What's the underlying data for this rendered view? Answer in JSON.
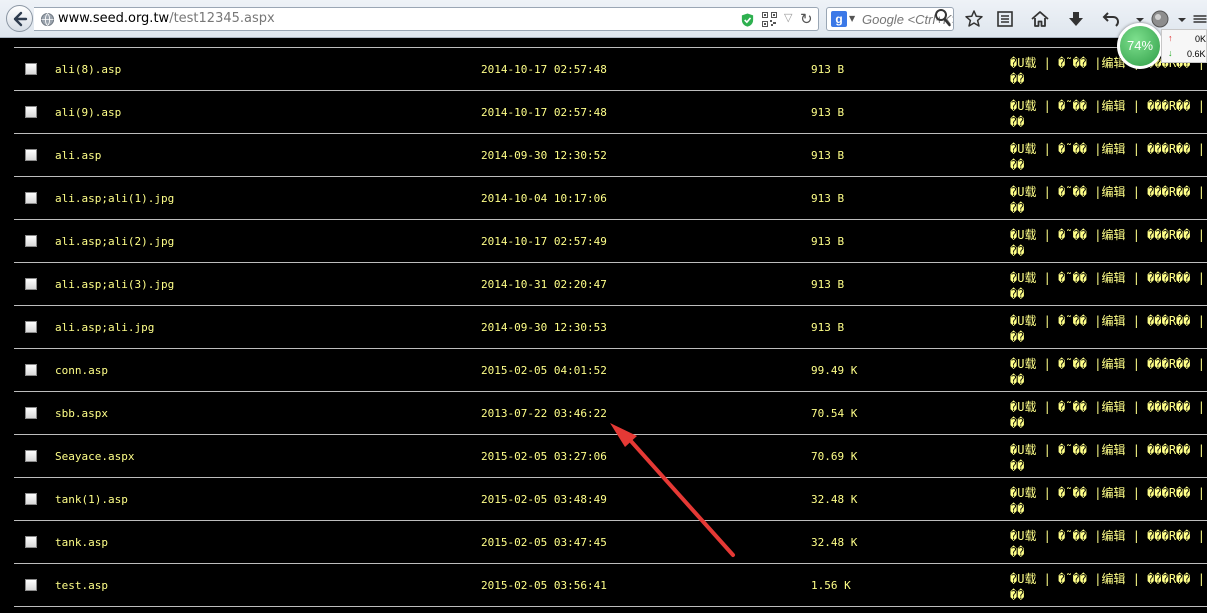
{
  "browser": {
    "url_host": "www.seed.org.tw",
    "url_path": "/test12345.aspx",
    "search_placeholder": "Google <Ctrl+K>",
    "search_engine": "Google",
    "speed_percent": "74%",
    "upload_speed": "0K",
    "download_speed": "0.6K"
  },
  "files": [
    {
      "name": "ali(8).asp",
      "date": "2014-10-17 02:57:48",
      "size": "913 B",
      "actions": "�U载 | �˜�� |编辑 | ���R�� | ��"
    },
    {
      "name": "ali(9).asp",
      "date": "2014-10-17 02:57:48",
      "size": "913 B",
      "actions": "�U载 | �˜�� |编辑 | ���R�� | ��"
    },
    {
      "name": "ali.asp",
      "date": "2014-09-30 12:30:52",
      "size": "913 B",
      "actions": "�U载 | �˜�� |编辑 | ���R�� | ��"
    },
    {
      "name": "ali.asp;ali(1).jpg",
      "date": "2014-10-04 10:17:06",
      "size": "913 B",
      "actions": "�U载 | �˜�� |编辑 | ���R�� | ��"
    },
    {
      "name": "ali.asp;ali(2).jpg",
      "date": "2014-10-17 02:57:49",
      "size": "913 B",
      "actions": "�U载 | �˜�� |编辑 | ���R�� | ��"
    },
    {
      "name": "ali.asp;ali(3).jpg",
      "date": "2014-10-31 02:20:47",
      "size": "913 B",
      "actions": "�U载 | �˜�� |编辑 | ���R�� | ��"
    },
    {
      "name": "ali.asp;ali.jpg",
      "date": "2014-09-30 12:30:53",
      "size": "913 B",
      "actions": "�U载 | �˜�� |编辑 | ���R�� | ��"
    },
    {
      "name": "conn.asp",
      "date": "2015-02-05 04:01:52",
      "size": "99.49 K",
      "actions": "�U载 | �˜�� |编辑 | ���R�� | ��"
    },
    {
      "name": "sbb.aspx",
      "date": "2013-07-22 03:46:22",
      "size": "70.54 K",
      "actions": "�U载 | �˜�� |编辑 | ���R�� | ��"
    },
    {
      "name": "Seayace.aspx",
      "date": "2015-02-05 03:27:06",
      "size": "70.69 K",
      "actions": "�U载 | �˜�� |编辑 | ���R�� | ��"
    },
    {
      "name": "tank(1).asp",
      "date": "2015-02-05 03:48:49",
      "size": "32.48 K",
      "actions": "�U载 | �˜�� |编辑 | ���R�� | ��"
    },
    {
      "name": "tank.asp",
      "date": "2015-02-05 03:47:45",
      "size": "32.48 K",
      "actions": "�U载 | �˜�� |编辑 | ���R�� | ��"
    },
    {
      "name": "test.asp",
      "date": "2015-02-05 03:56:41",
      "size": "1.56 K",
      "actions": "�U载 | �˜�� |编辑 | ���R�� | ��"
    }
  ],
  "colors": {
    "page_background": "#000000",
    "text_yellow": "#ffff88",
    "row_divider": "#bdbdbd",
    "annotation_arrow": "#e53935",
    "speed_badge": "#3aa853"
  }
}
